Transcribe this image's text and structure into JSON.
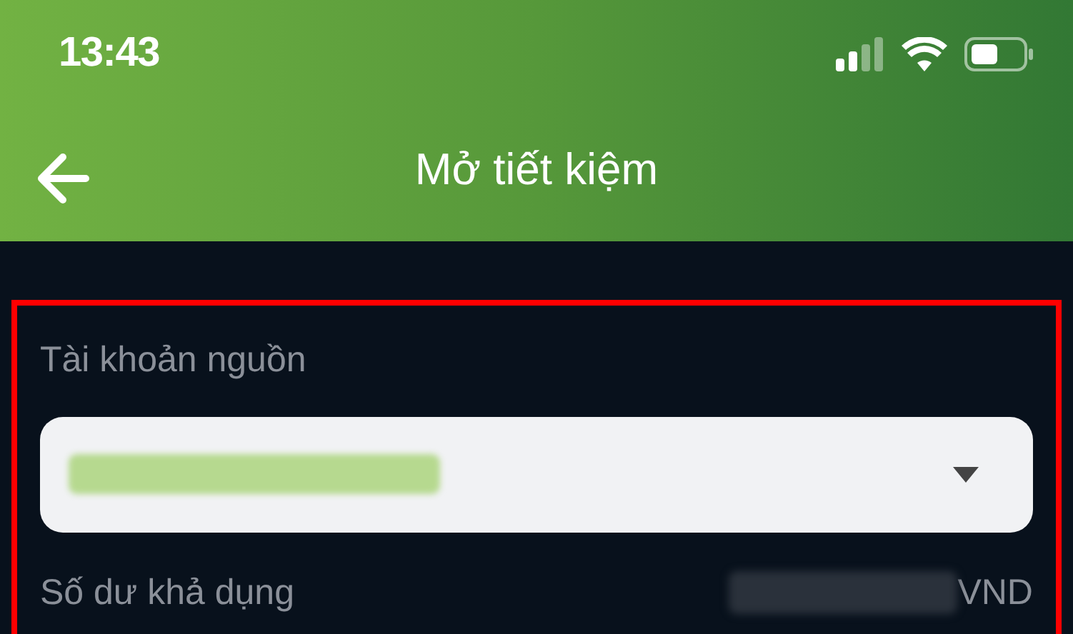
{
  "status_bar": {
    "time": "13:43"
  },
  "header": {
    "title": "Mở tiết kiệm"
  },
  "form": {
    "source_account": {
      "label": "Tài khoản nguồn"
    },
    "balance": {
      "label": "Số dư khả dụng",
      "currency": "VND"
    }
  }
}
